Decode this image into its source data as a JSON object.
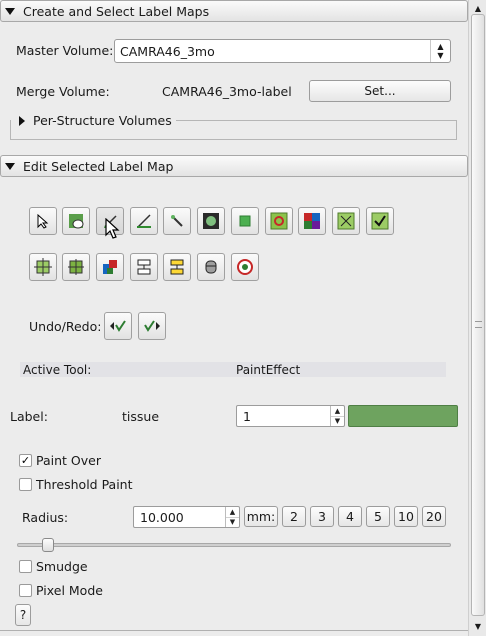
{
  "sections": {
    "create_select": {
      "title": "Create and Select Label Maps"
    },
    "edit_selected": {
      "title": "Edit Selected Label Map"
    }
  },
  "master_volume": {
    "label": "Master Volume:",
    "value": "CAMRA46_3mo"
  },
  "merge_volume": {
    "label": "Merge Volume:",
    "value": "CAMRA46_3mo-label",
    "set_button": "Set..."
  },
  "per_structure": {
    "label": "Per-Structure Volumes"
  },
  "toolbar": {
    "row1": [
      "pointer-tool-icon",
      "paint-tool-icon",
      "draw-tool-icon",
      "level-tracing-icon",
      "wand-icon",
      "image-icon",
      "rectangle-icon",
      "grow-region-icon",
      "threshold-grid-icon",
      "erode-grid-icon",
      "check-grid-icon"
    ],
    "row2": [
      "dilate-icon",
      "morphology-icon",
      "island-icon",
      "split-icon",
      "merge-icon",
      "cylinder-icon",
      "target-icon"
    ]
  },
  "undo_redo": {
    "label": "Undo/Redo:"
  },
  "active_tool": {
    "label": "Active Tool:",
    "value": "PaintEffect"
  },
  "label": {
    "label": "Label:",
    "name": "tissue",
    "value": "1",
    "color": "#6ea35f"
  },
  "paint_over": {
    "label": "Paint Over",
    "checked": true
  },
  "threshold_paint": {
    "label": "Threshold Paint",
    "checked": false
  },
  "radius": {
    "label": "Radius:",
    "value": "10.000",
    "unit": "mm:",
    "presets": [
      "2",
      "3",
      "4",
      "5",
      "10",
      "20"
    ],
    "slider_fraction": 0.06
  },
  "smudge": {
    "label": "Smudge",
    "checked": false
  },
  "pixel_mode": {
    "label": "Pixel Mode",
    "checked": false
  },
  "help": {
    "label": "?"
  }
}
